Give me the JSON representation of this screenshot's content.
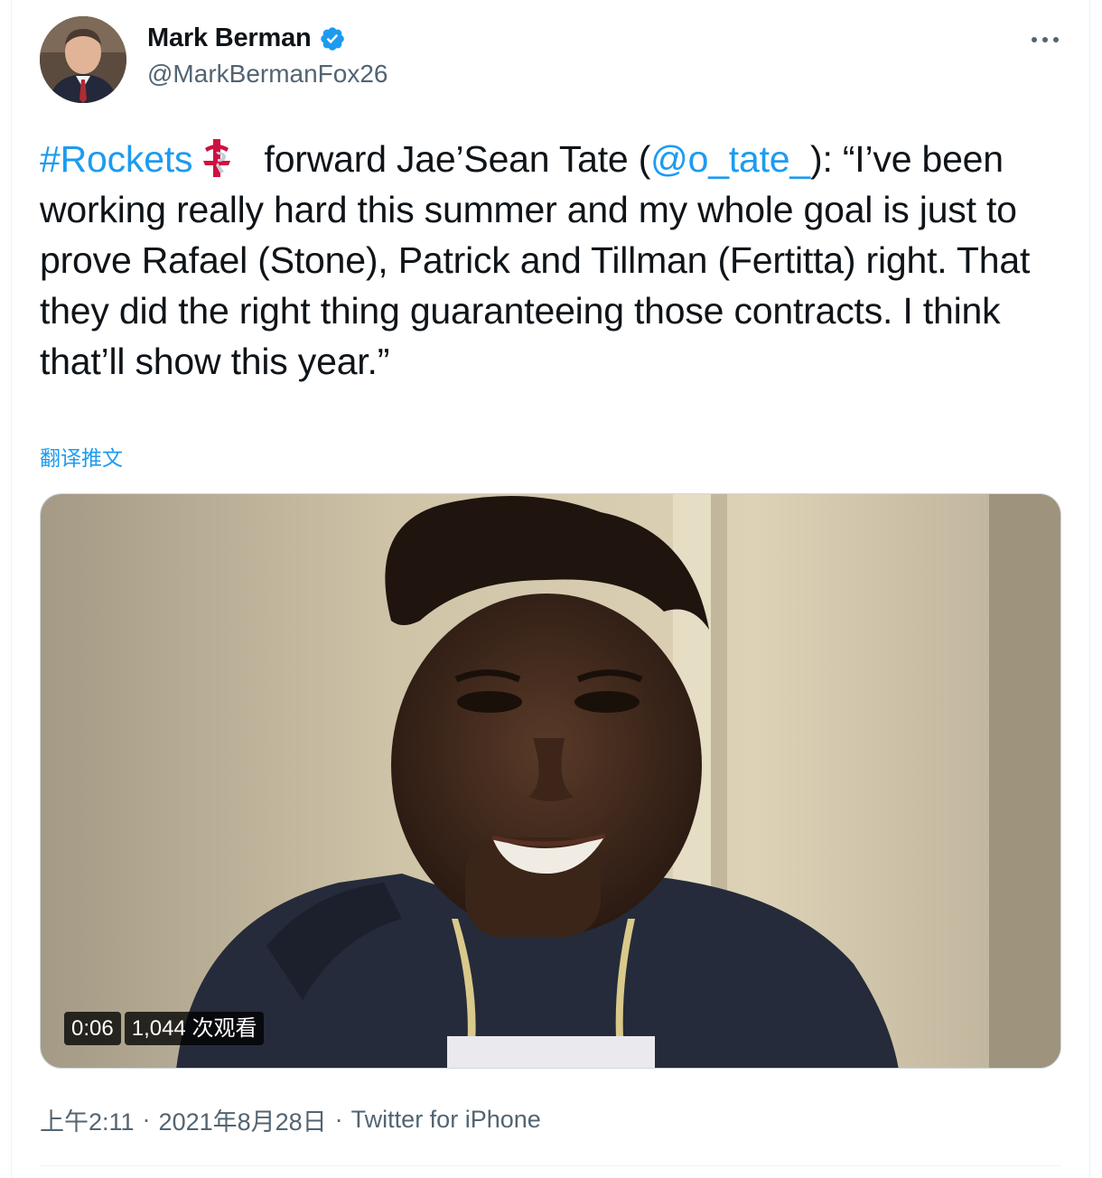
{
  "author": {
    "display_name": "Mark Berman",
    "handle": "@MarkBermanFox26",
    "verified": true
  },
  "tweet": {
    "hashtag": "#Rockets",
    "text_part1": " forward Jae’Sean Tate (",
    "mention": "@o_tate_",
    "text_part2": "): “I’ve been working really hard this summer and my whole goal is just to prove Rafael (Stone), Patrick and Tillman (Fertitta) right. That they did the right thing guaranteeing those contracts. I think that’ll show this year.”",
    "translate_label": "翻译推文"
  },
  "video": {
    "duration": "0:06",
    "views": "1,044 次观看"
  },
  "meta": {
    "time": "上午2:11",
    "separator": "·",
    "date": "2021年8月28日",
    "source": "Twitter for iPhone"
  },
  "icons": {
    "verified": "verified-badge-icon",
    "more": "more-dots-icon",
    "team": "rockets-logo-icon"
  },
  "colors": {
    "link": "#1d9bf0",
    "secondary_text": "#536471",
    "rockets_red": "#ce1141"
  }
}
